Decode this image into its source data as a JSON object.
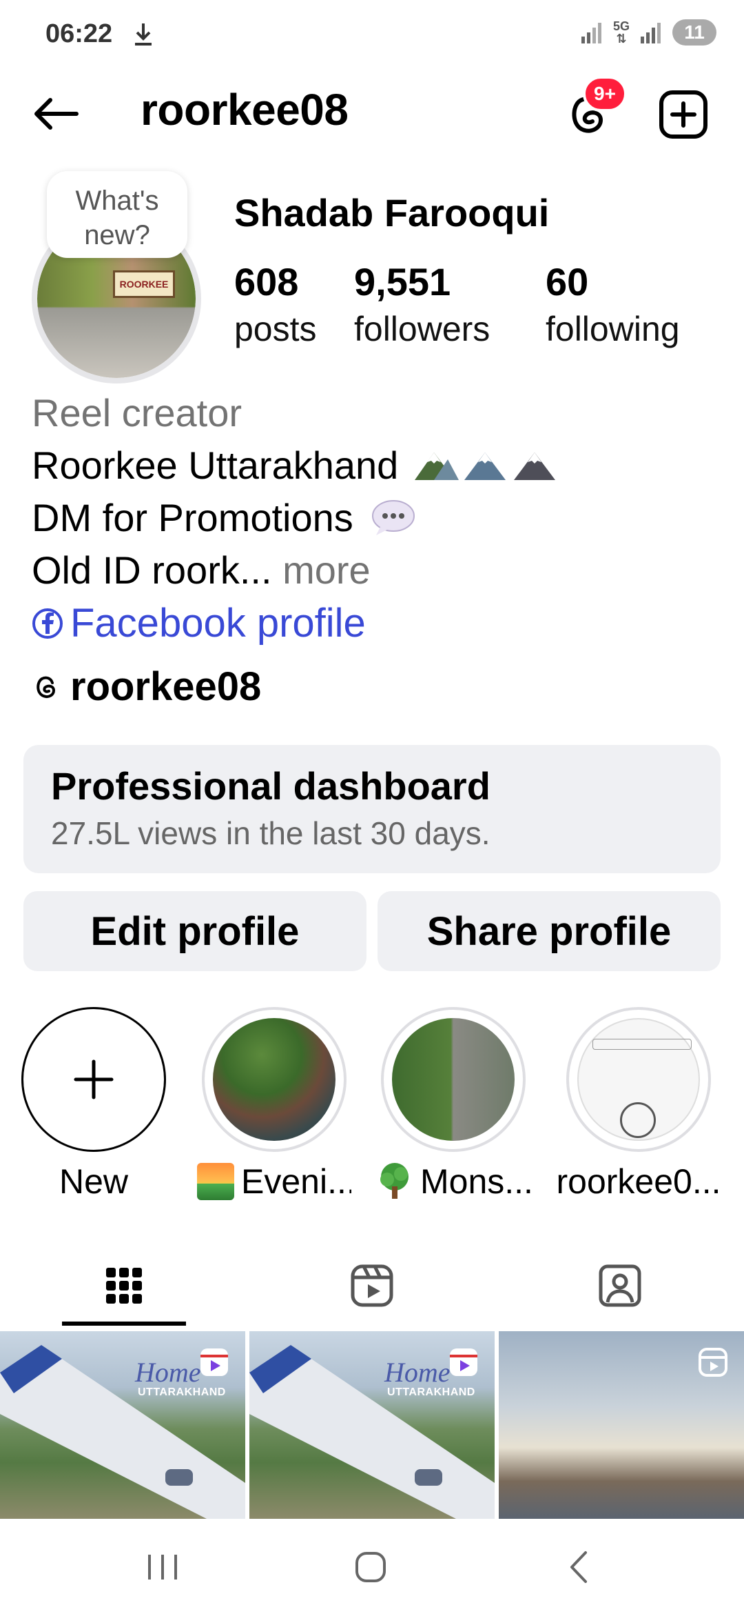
{
  "status_bar": {
    "time": "06:22",
    "network": "5G",
    "battery": "11",
    "icons": [
      "download-icon",
      "signal-icon",
      "signal-icon"
    ]
  },
  "header": {
    "username": "roorkee08",
    "notification_badge": "9+",
    "icons": [
      "back-arrow-icon",
      "threads-icon",
      "create-plus-icon"
    ]
  },
  "profile": {
    "note": "What's new?",
    "full_name": "Shadab Farooqui",
    "stats": {
      "posts": {
        "value": "608",
        "label": "posts"
      },
      "followers": {
        "value": "9,551",
        "label": "followers"
      },
      "following": {
        "value": "60",
        "label": "following"
      }
    }
  },
  "bio": {
    "category": "Reel creator",
    "line1": "Roorkee Uttarakhand",
    "line2": "DM for Promotions",
    "line3": "Old ID roork...",
    "more": "more",
    "facebook_link": "Facebook profile",
    "threads_handle": "roorkee08"
  },
  "dashboard": {
    "title": "Professional dashboard",
    "subtitle": "27.5L views in the last 30 days."
  },
  "actions": {
    "edit_label": "Edit profile",
    "share_label": "Share profile"
  },
  "highlights": [
    {
      "label": "New"
    },
    {
      "label": "Eveni..."
    },
    {
      "label": "Mons..."
    },
    {
      "label": "roorkee0..."
    }
  ],
  "tabs": [
    "grid-icon",
    "reels-icon",
    "tagged-icon"
  ],
  "posts": [
    {
      "caption": "Home",
      "subcaption": "UTTARAKHAND"
    },
    {
      "caption": "Home",
      "subcaption": "UTTARAKHAND"
    },
    {
      "caption": "",
      "subcaption": ""
    }
  ],
  "colors": {
    "link_blue": "#3949d6",
    "badge_red": "#ff1e3c",
    "button_bg": "#eff0f3",
    "muted_text": "#737373"
  }
}
